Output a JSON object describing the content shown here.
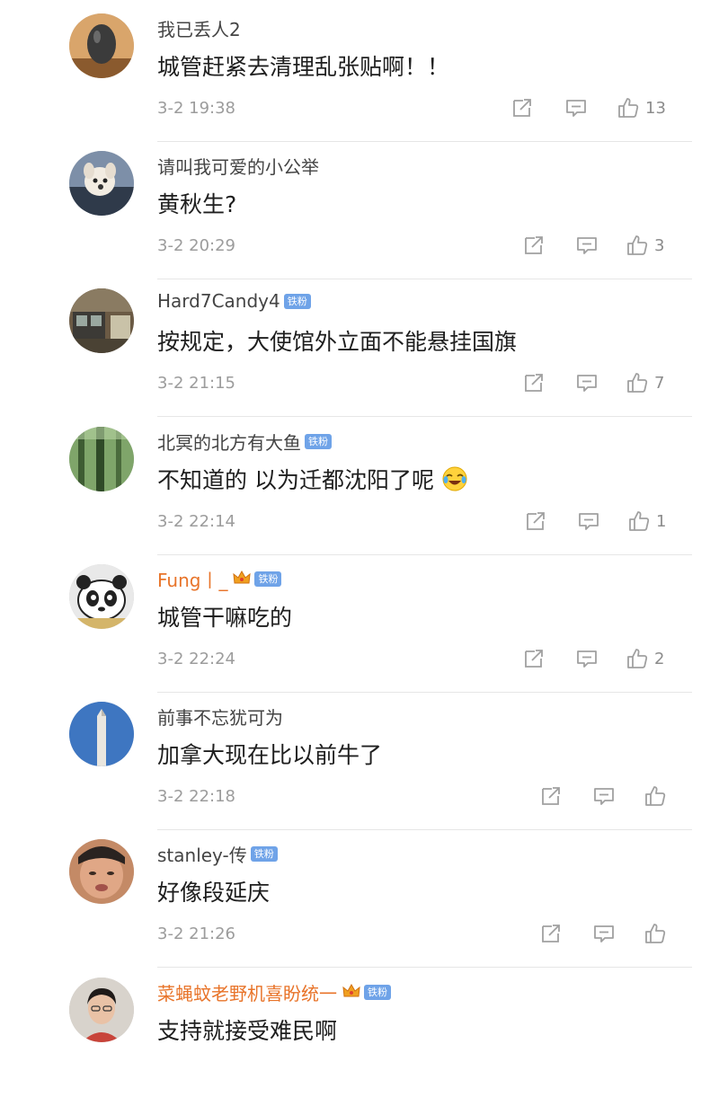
{
  "comments": [
    {
      "username": "我已丢人2",
      "vip": false,
      "badge": "",
      "text": "城管赶紧去清理乱张贴啊！！",
      "emoji": false,
      "time": "3-2 19:38",
      "likes": "13",
      "avatar": "egg-stone"
    },
    {
      "username": "请叫我可爱的小公举",
      "vip": false,
      "badge": "",
      "text": "黄秋生?",
      "emoji": false,
      "time": "3-2 20:29",
      "likes": "3",
      "avatar": "dog"
    },
    {
      "username": "Hard7Candy4",
      "vip": false,
      "badge": "铁粉",
      "text": "按规定，大使馆外立面不能悬挂国旗",
      "emoji": false,
      "time": "3-2 21:15",
      "likes": "7",
      "avatar": "street"
    },
    {
      "username": "北冥的北方有大鱼",
      "vip": false,
      "badge": "铁粉",
      "text": "不知道的 以为迁都沈阳了呢",
      "emoji": true,
      "time": "3-2 22:14",
      "likes": "1",
      "avatar": "forest"
    },
    {
      "username": "Fung丨_",
      "vip": true,
      "badge": "铁粉",
      "text": "城管干嘛吃的",
      "emoji": false,
      "time": "3-2 22:24",
      "likes": "2",
      "avatar": "panda"
    },
    {
      "username": "前事不忘犹可为",
      "vip": false,
      "badge": "",
      "text": "加拿大现在比以前牛了",
      "emoji": false,
      "time": "3-2 22:18",
      "likes": "",
      "avatar": "obelisk"
    },
    {
      "username": "stanley-传",
      "vip": false,
      "badge": "铁粉",
      "text": "好像段延庆",
      "emoji": false,
      "time": "3-2 21:26",
      "likes": "",
      "avatar": "child"
    },
    {
      "username": "菜蝇蚊老野机喜盼统一",
      "vip": true,
      "badge": "铁粉",
      "text": "支持就接受难民啊",
      "emoji": false,
      "time": "",
      "likes": "",
      "avatar": "woman"
    }
  ],
  "icons": {
    "repost": "repost-icon",
    "comment": "comment-icon",
    "like": "like-icon",
    "crown": "crown-icon",
    "emoji": "laugh-cry-emoji-icon"
  },
  "colors": {
    "vip_name": "#e8742a",
    "badge": "#6fa3e8",
    "icon": "#a0a0a0"
  }
}
